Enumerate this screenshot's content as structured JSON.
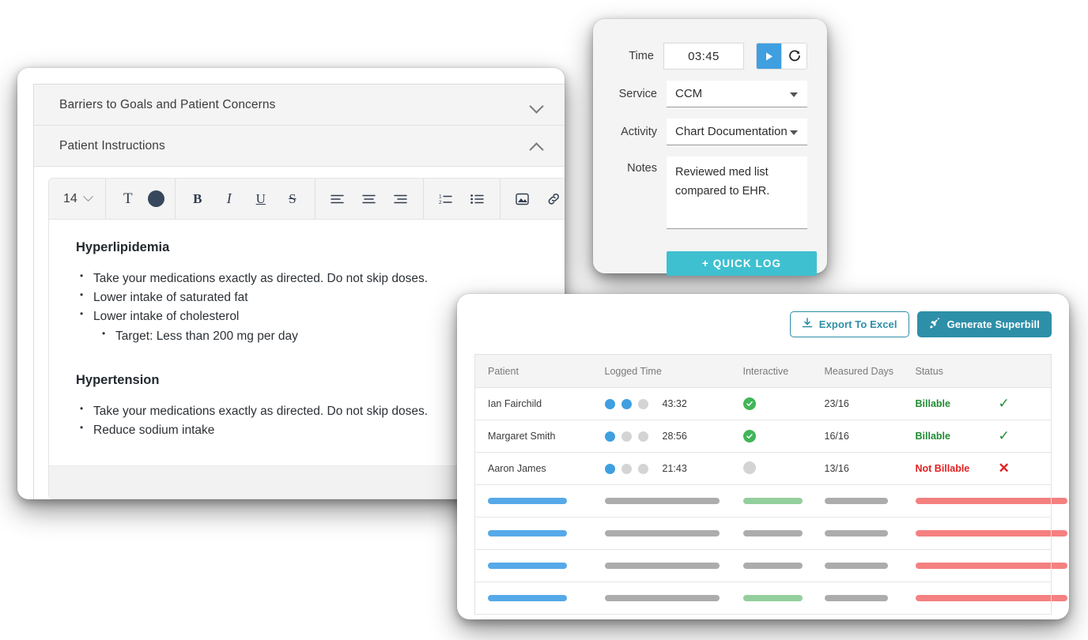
{
  "editor": {
    "accordions": [
      {
        "title": "Barriers to Goals and Patient Concerns",
        "icon": "chevron-down-icon",
        "expanded": false
      },
      {
        "title": "Patient Instructions",
        "icon": "chevron-up-icon",
        "expanded": true
      }
    ],
    "toolbar": {
      "font_size": "14",
      "text_color": "#37475c",
      "buttons": [
        {
          "name": "font-size-dropdown",
          "label": "14"
        },
        {
          "name": "text-format-icon",
          "label": "T"
        },
        {
          "name": "text-color-icon",
          "label": ""
        },
        {
          "name": "bold-icon",
          "label": "B"
        },
        {
          "name": "italic-icon",
          "label": "I"
        },
        {
          "name": "underline-icon",
          "label": "U"
        },
        {
          "name": "strikethrough-icon",
          "label": "S"
        },
        {
          "name": "align-left-icon",
          "label": ""
        },
        {
          "name": "align-center-icon",
          "label": ""
        },
        {
          "name": "align-right-icon",
          "label": ""
        },
        {
          "name": "numbered-list-icon",
          "label": ""
        },
        {
          "name": "bulleted-list-icon",
          "label": ""
        },
        {
          "name": "insert-image-icon",
          "label": ""
        },
        {
          "name": "insert-link-icon",
          "label": ""
        }
      ]
    },
    "content": {
      "section1_heading": "Hyperlipidemia",
      "section1_items": [
        "Take your medications exactly as directed. Do not skip doses.",
        "Lower intake of saturated fat",
        "Lower intake of cholesterol"
      ],
      "section1_sub_item": "Target: Less than 200 mg per day",
      "section2_heading": "Hypertension",
      "section2_items": [
        "Take your medications exactly as directed. Do not skip doses.",
        "Reduce sodium intake"
      ]
    }
  },
  "timer": {
    "time_label": "Time",
    "time_value": "03:45",
    "play_icon": "play-icon",
    "reset_icon": "reset-icon",
    "play_color": "#3f9fe0",
    "service_label": "Service",
    "service_value": "CCM",
    "activity_label": "Activity",
    "activity_value": "Chart Documentation",
    "notes_label": "Notes",
    "notes_value": "Reviewed med list compared to EHR.",
    "quick_log_label": "+ QUICK LOG",
    "quick_log_color": "#3fc0d0"
  },
  "billing": {
    "actions": {
      "export_label": "Export To Excel",
      "export_icon": "download-icon",
      "superbill_label": "Generate Superbill",
      "superbill_icon": "rocket-icon",
      "accent": "#2e8fa8"
    },
    "columns": [
      "Patient",
      "Logged Time",
      "Interactive",
      "Measured Days",
      "Status",
      ""
    ],
    "rows": [
      {
        "patient": "Ian Fairchild",
        "dots": [
          true,
          true,
          false
        ],
        "logged_time": "43:32",
        "interactive": true,
        "measured_days": "23/16",
        "status": "Billable",
        "status_type": "billable",
        "mark": "✓"
      },
      {
        "patient": "Margaret Smith",
        "dots": [
          true,
          false,
          false
        ],
        "logged_time": "28:56",
        "interactive": true,
        "measured_days": "16/16",
        "status": "Billable",
        "status_type": "billable",
        "mark": "✓"
      },
      {
        "patient": "Aaron James",
        "dots": [
          true,
          false,
          false
        ],
        "logged_time": "21:43",
        "interactive": false,
        "measured_days": "13/16",
        "status": "Not Billable",
        "status_type": "not-billable",
        "mark": "✕"
      }
    ],
    "skeleton_rows": [
      {
        "third_bar": "green"
      },
      {
        "third_bar": "gray"
      },
      {
        "third_bar": "gray"
      },
      {
        "third_bar": "green"
      }
    ],
    "skeleton_colors": {
      "blue": "#56a9e8",
      "gray": "#acacac",
      "green": "#93cf9c",
      "red": "#f58080"
    }
  }
}
